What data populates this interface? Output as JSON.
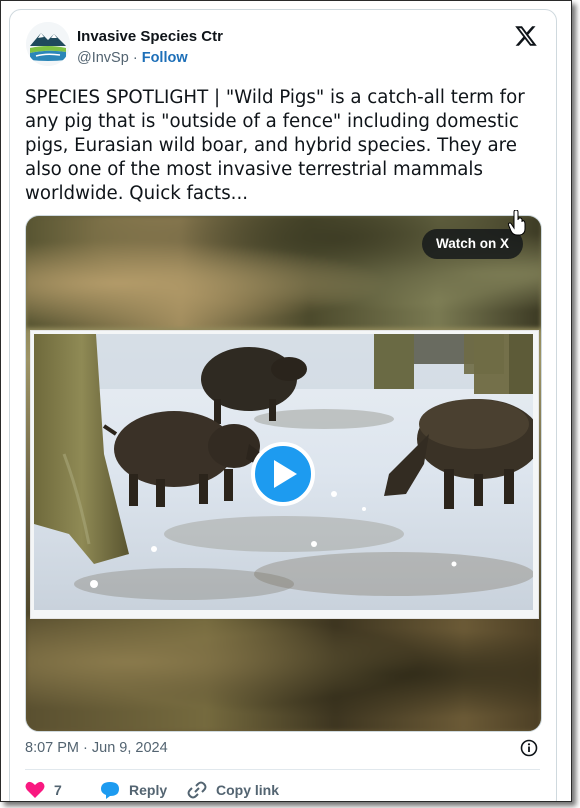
{
  "author": {
    "name": "Invasive Species Ctr",
    "handle": "@InvSp",
    "separator": "·",
    "follow_label": "Follow",
    "avatar_icon": "mountain-lake-logo",
    "follow_color": "#1d6fb8"
  },
  "platform_icon": "x-logo-icon",
  "tweet": {
    "text": "SPECIES SPOTLIGHT | \"Wild Pigs\" is a catch-all term for any pig that is \"outside of a fence\" including domestic pigs, Eurasian wild boar, and hybrid species. They are also one of the most invasive terrestrial mammals worldwide. Quick facts..."
  },
  "media": {
    "watch_label": "Watch on X",
    "play_icon": "play-icon",
    "accent": "#1d9bf0"
  },
  "footer": {
    "timestamp": "8:07 PM · Jun 9, 2024",
    "info_icon": "info-icon"
  },
  "actions": {
    "like_count": "7",
    "reply_label": "Reply",
    "copy_link_label": "Copy link",
    "like_color": "#f91880"
  }
}
